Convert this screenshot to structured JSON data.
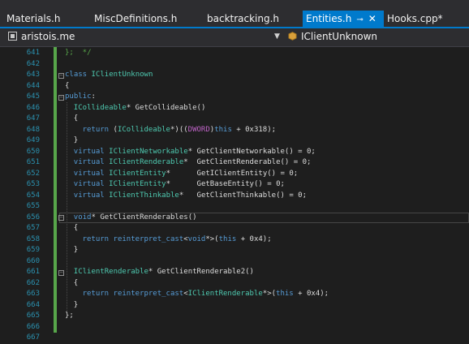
{
  "tabs": [
    {
      "label": "Materials.h"
    },
    {
      "label": "MiscDefinitions.h"
    },
    {
      "label": "backtracking.h"
    },
    {
      "label": "Entities.h",
      "active": true
    },
    {
      "label": "Hooks.cpp*"
    }
  ],
  "tab_icons": {
    "pin": "pin-icon",
    "close": "close-icon"
  },
  "navbar": {
    "project": "aristois.me",
    "scope": "IClientUnknown"
  },
  "colors": {
    "accent": "#007acc",
    "line_number": "#2b91af",
    "keyword": "#569cd6",
    "type": "#4ec9b0",
    "macro": "#bd63c5",
    "comment": "#57a64a",
    "change_bar": "#57a64a"
  },
  "editor": {
    "current_line": "656",
    "lines": [
      {
        "n": "641",
        "text": "};  */"
      },
      {
        "n": "642",
        "text": ""
      },
      {
        "n": "643",
        "text": "class IClientUnknown"
      },
      {
        "n": "644",
        "text": "{"
      },
      {
        "n": "645",
        "text": "public:"
      },
      {
        "n": "646",
        "text": "ICollideable* GetCollideable()"
      },
      {
        "n": "647",
        "text": "{"
      },
      {
        "n": "648",
        "text": "return (ICollideable*)((DWORD)this + 0x318);"
      },
      {
        "n": "649",
        "text": "}"
      },
      {
        "n": "650",
        "text": "virtual IClientNetworkable* GetClientNetworkable() = 0;"
      },
      {
        "n": "651",
        "text": "virtual IClientRenderable*  GetClientRenderable() = 0;"
      },
      {
        "n": "652",
        "text": "virtual IClientEntity*      GetIClientEntity() = 0;"
      },
      {
        "n": "653",
        "text": "virtual IClientEntity*      GetBaseEntity() = 0;"
      },
      {
        "n": "654",
        "text": "virtual IClientThinkable*   GetClientThinkable() = 0;"
      },
      {
        "n": "655",
        "text": ""
      },
      {
        "n": "656",
        "text": "void* GetClientRenderables()"
      },
      {
        "n": "657",
        "text": "{"
      },
      {
        "n": "658",
        "text": "return reinterpret_cast<void*>(this + 0x4);"
      },
      {
        "n": "659",
        "text": "}"
      },
      {
        "n": "660",
        "text": ""
      },
      {
        "n": "661",
        "text": "IClientRenderable* GetClientRenderable2()"
      },
      {
        "n": "662",
        "text": "{"
      },
      {
        "n": "663",
        "text": "return reinterpret_cast<IClientRenderable*>(this + 0x4);"
      },
      {
        "n": "664",
        "text": "}"
      },
      {
        "n": "665",
        "text": "};"
      },
      {
        "n": "666",
        "text": ""
      },
      {
        "n": "667",
        "text": ""
      }
    ]
  }
}
